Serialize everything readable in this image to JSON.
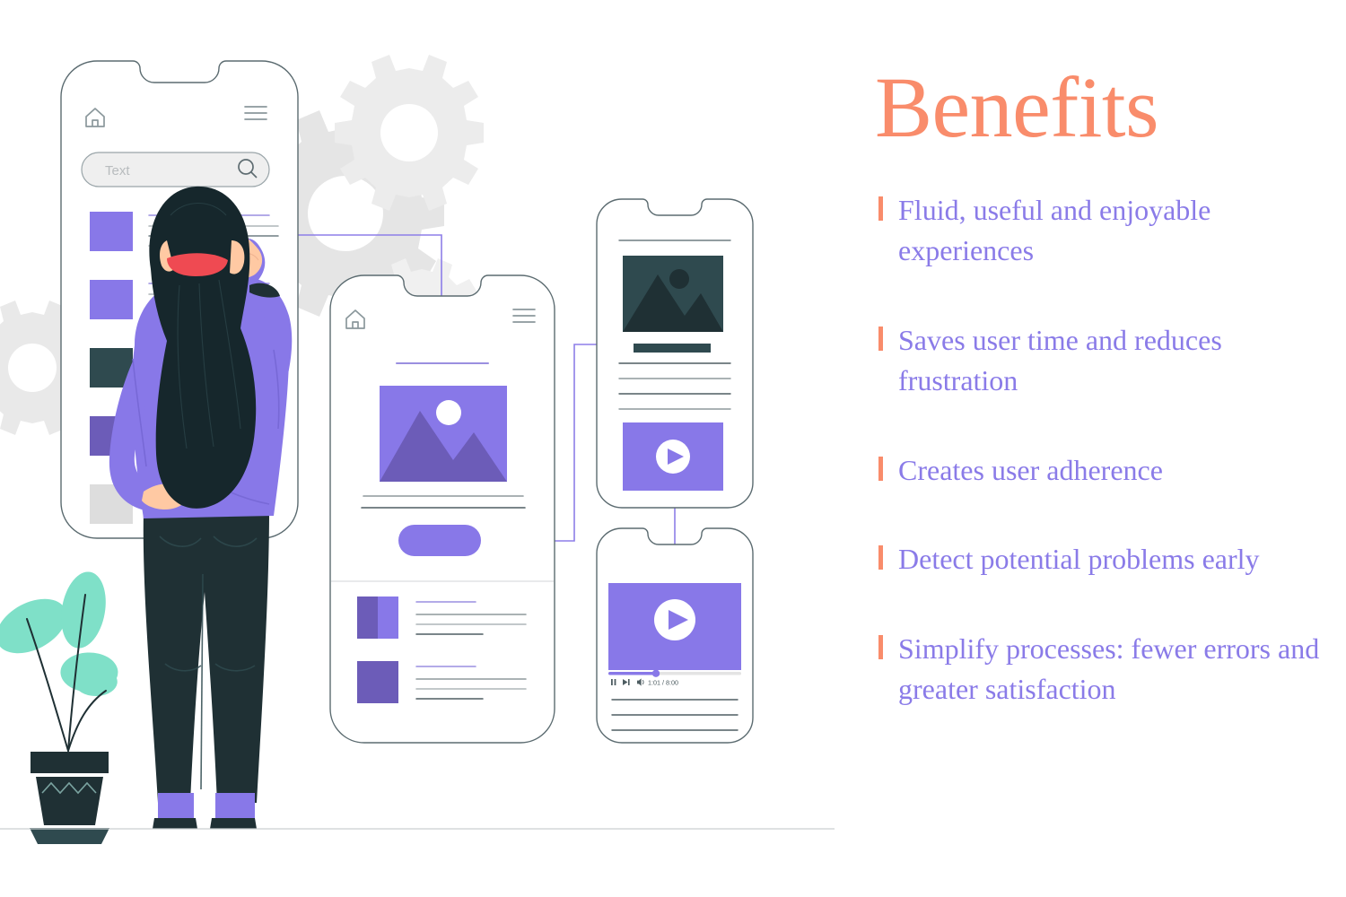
{
  "slide": {
    "title": "Benefits",
    "title_color": "#f98c6b",
    "text_color": "#8a7be8",
    "background": "#ffffff"
  },
  "benefits": [
    {
      "id": "fluid-experiences",
      "text": "Fluid, useful and enjoyable experiences"
    },
    {
      "id": "saves-time",
      "text": "Saves user time and reduces frustration"
    },
    {
      "id": "user-adherence",
      "text": "Creates user adherence"
    },
    {
      "id": "detect-problems",
      "text": "Detect potential problems early"
    },
    {
      "id": "simplify-processes",
      "text": "Simplify processes: fewer errors and greater satisfaction"
    }
  ],
  "illustration": {
    "colors": {
      "purple": "#8878e8",
      "purple_dark": "#6c5cb8",
      "purple_line": "#8d7ee8",
      "teal_dark": "#2f4a4f",
      "navy": "#1f3034",
      "mint": "#7fe0c8",
      "gray_gear": "#e8e8e8",
      "gray_light": "#dddddd",
      "skin": "#ffc9a3",
      "hair": "#16272c",
      "hair_tie": "#ef4a52",
      "outline": "#4a5a5e"
    },
    "phone_one": {
      "name": "search-screen",
      "home_icon": "home-icon",
      "menu_icon": "hamburger-menu-icon",
      "search_placeholder": "Text",
      "search_icon": "search-icon",
      "thumbnail_count": 5
    },
    "phone_two": {
      "name": "article-screen",
      "home_icon": "home-icon",
      "menu_icon": "hamburger-menu-icon",
      "image_icon": "image-placeholder-icon",
      "cta_button": "",
      "list_item_count": 2
    },
    "phone_three": {
      "name": "media-article-screen",
      "image_icon": "image-placeholder-icon",
      "video_icon": "play-button-icon"
    },
    "phone_four": {
      "name": "video-player-screen",
      "video_icon": "play-button-icon",
      "pause_icon": "pause-icon",
      "next_icon": "skip-next-icon",
      "volume_icon": "volume-icon",
      "timestamp": "1:01 / 8:00",
      "progress_percent": 36
    },
    "person": {
      "name": "woman-pointing-at-screen",
      "sweater_color": "#8878e8",
      "jeans_color": "#1f3034",
      "hair_color": "#16272c",
      "hair_tie_color": "#ef4a52",
      "socks_color": "#8878e8"
    },
    "plant": {
      "name": "potted-plant",
      "leaf_color": "#7fe0c8",
      "pot_color": "#1f3034"
    },
    "gears": [
      {
        "name": "gear-large-left",
        "size": "large"
      },
      {
        "name": "gear-large-mid",
        "size": "large"
      },
      {
        "name": "gear-medium-top",
        "size": "medium"
      },
      {
        "name": "gear-small-mid",
        "size": "small"
      }
    ],
    "connectors": [
      {
        "name": "connector-phone1-to-phone2"
      },
      {
        "name": "connector-phone2-to-phone3"
      },
      {
        "name": "connector-phone3-to-phone4"
      }
    ]
  }
}
